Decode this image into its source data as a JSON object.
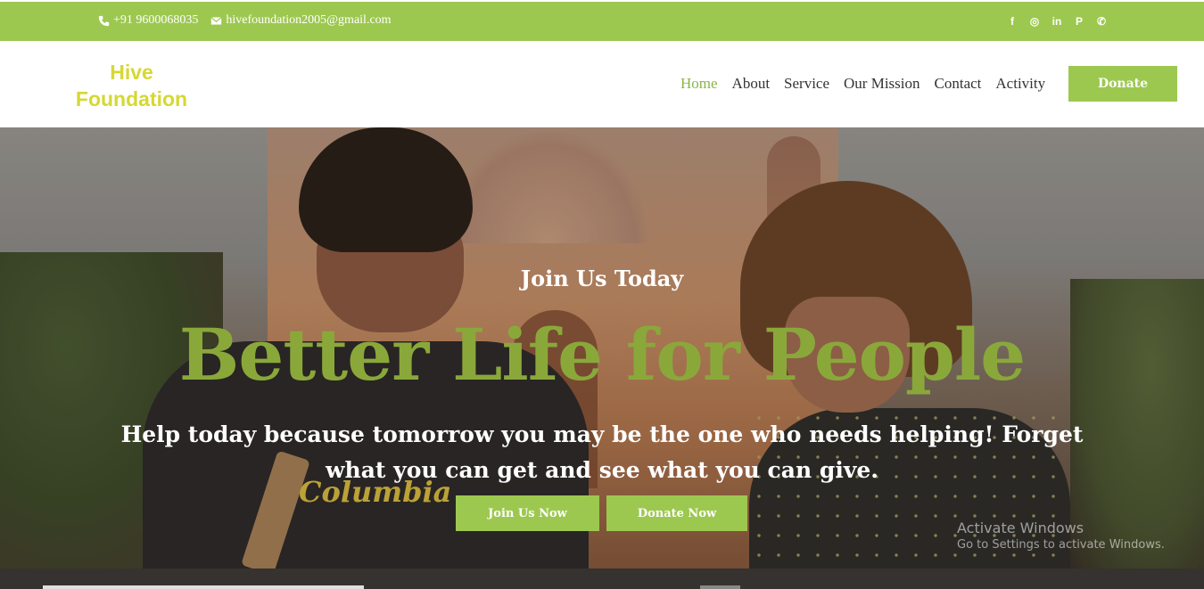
{
  "topbar": {
    "phone": "+91 9600068035",
    "email": "hivefoundation2005@gmail.com",
    "social": [
      {
        "icon": "facebook-icon",
        "glyph": "f"
      },
      {
        "icon": "instagram-icon",
        "glyph": "◎"
      },
      {
        "icon": "linkedin-icon",
        "glyph": "in"
      },
      {
        "icon": "pinterest-icon",
        "glyph": "P"
      },
      {
        "icon": "whatsapp-icon",
        "glyph": "✆"
      }
    ]
  },
  "header": {
    "logo_line1": "Hive",
    "logo_line2": "Foundation",
    "nav": [
      "Home",
      "About",
      "Service",
      "Our Mission",
      "Contact",
      "Activity"
    ],
    "active_nav": "Home",
    "donate_label": "Donate"
  },
  "hero": {
    "eyebrow": "Join Us Today",
    "headline": "Better Life for People",
    "tagline": "Help today because tomorrow you may be the one who needs helping! Forget what you can get and see what you can give.",
    "shirt_print": "Columbia",
    "buttons": {
      "join": "Join Us Now",
      "donate": "Donate Now"
    }
  },
  "watermark": {
    "title": "Activate Windows",
    "subtitle": "Go to Settings to activate Windows."
  },
  "colors": {
    "accent": "#9dc850",
    "headline": "#8aa83a",
    "logo": "#d6d832"
  }
}
